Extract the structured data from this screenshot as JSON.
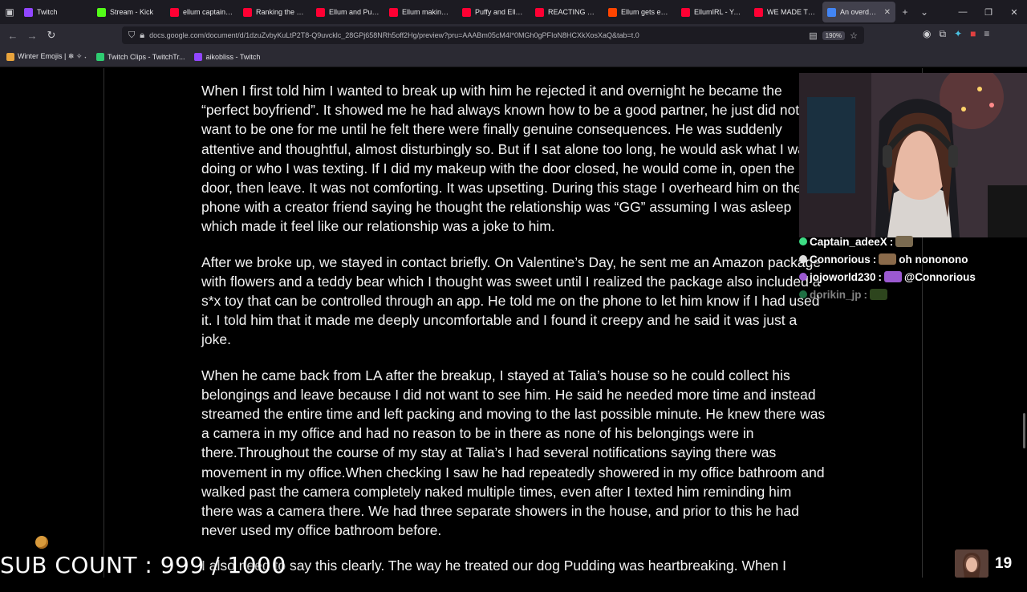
{
  "browser": {
    "tabs": [
      {
        "label": "Twitch",
        "color": "#9146ff"
      },
      {
        "label": "Stream - Kick",
        "color": "#53fc18"
      },
      {
        "label": "ellum captainpuff",
        "color": "#ff0033"
      },
      {
        "label": "Ranking the best",
        "color": "#ff0033"
      },
      {
        "label": "Ellum and Puffy r",
        "color": "#ff0033"
      },
      {
        "label": "Ellum making cha",
        "color": "#ff0033"
      },
      {
        "label": "Puffy and Ellum a",
        "color": "#ff0033"
      },
      {
        "label": "REACTING TO SI",
        "color": "#ff0033"
      },
      {
        "label": "Ellum gets expos",
        "color": "#ff4500"
      },
      {
        "label": "EllumIRL - YouTu",
        "color": "#ff0033"
      },
      {
        "label": "WE MADE THE W",
        "color": "#ff0033"
      },
      {
        "label": "An overdue ex",
        "color": "#4285f4"
      }
    ],
    "url": "docs.google.com/document/d/1dzuZvbyKuLtP2T8-Q9uvcklc_28GPj658NRh5off2Hg/preview?pru=AAABm05cM4I*0MGh0gPFIoN8HCXkXosXaQ&tab=t.0",
    "zoom": "190%",
    "bookmarks": [
      {
        "label": "Winter Emojis | ❄ ✧ ˖",
        "color": "#e8a33c"
      },
      {
        "label": "Twitch Clips - TwitchTr...",
        "color": "#2ecc71"
      },
      {
        "label": "aikobliss - Twitch",
        "color": "#9146ff"
      }
    ]
  },
  "document": {
    "paragraphs": [
      "When I first told him I wanted to break up with him he rejected it and overnight he became the “perfect boyfriend”. It showed me he had always known how to be a good partner, he just did not want to be one for me until he felt there were finally genuine consequences. He was suddenly attentive and thoughtful, almost disturbingly so. But if I sat alone too long, he would ask what I was doing or who I was texting. If I did my makeup with the door closed, he would come in, open the door, then leave. It was not comforting. It was upsetting. During this stage I overheard him on the phone with a creator friend saying he thought the relationship was “GG” assuming I was asleep which made it feel like our relationship was a joke to him.",
      "After we broke up, we stayed in contact briefly. On Valentine’s Day, he sent me an Amazon package with flowers and a teddy bear which I thought was sweet until I realized the package also included a s*x toy that can be controlled through an app. He told me on the phone to let him know if I had used it. I told him that it made me deeply uncomfortable and I found it creepy and he said it was just a joke.",
      "When he came back from LA after the breakup, I stayed at Talia’s house so he could collect his belongings and leave because I did not want to see him. He said he needed more time and instead streamed the entire time and left packing and moving to the last possible minute. He knew there was a camera in my office and had no reason to be in there as none of his belongings were in there.Throughout the course of my stay at Talia’s I had several notifications saying there was movement in my office.When checking I saw he had repeatedly showered in my office bathroom and walked past the camera completely naked multiple times, even after I texted him reminding him there was a camera there. We had three separate showers in the house, and prior to this he had never used my office bathroom before.",
      "I also need to say this clearly. The way he treated our dog Pudding was heartbreaking. When I"
    ]
  },
  "chat": [
    {
      "user": "Captain_adeeX",
      "message": "",
      "color": "#ffffff",
      "badge": "#3ddc84"
    },
    {
      "user": "Connorious",
      "message": "oh nononono",
      "color": "#ffffff",
      "badge": "#dddddd"
    },
    {
      "user": "jojoworld230",
      "message": "@Connorious",
      "color": "#ffffff",
      "badge": "#9b59d0"
    },
    {
      "user": "dorikin_jp",
      "message": "",
      "color": "#ffffff",
      "badge": "#3ddc84"
    }
  ],
  "overlay": {
    "sub_count": "SUB COUNT : 999 / 1000",
    "viewer_count": "19"
  }
}
